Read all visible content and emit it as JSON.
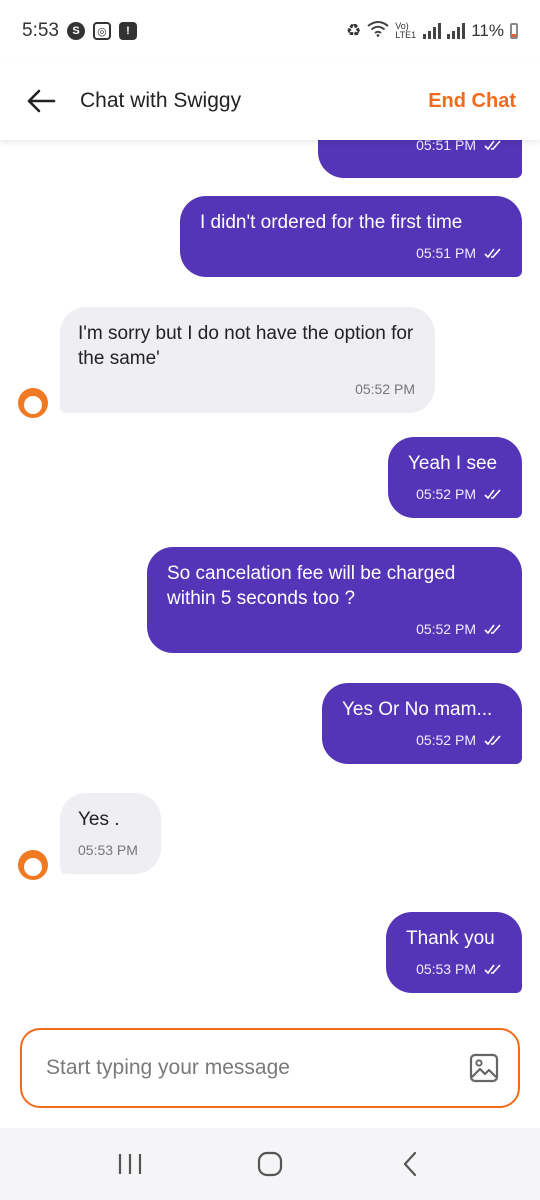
{
  "status_bar": {
    "time": "5:53",
    "battery_percent": "11%",
    "icons": [
      "skype-icon",
      "instagram-icon",
      "alert-icon",
      "battery-saver-icon",
      "wifi-icon",
      "signal-icon"
    ],
    "network_label": "Vo) LTE1"
  },
  "header": {
    "title": "Chat with Swiggy",
    "end_chat_label": "End Chat"
  },
  "messages": [
    {
      "from": "user",
      "text": "",
      "time": "05:51 PM"
    },
    {
      "from": "user",
      "text": "I didn't ordered for the first time",
      "time": "05:51 PM"
    },
    {
      "from": "agent",
      "text": "I'm sorry but I do not have the option for the same'",
      "time": "05:52 PM"
    },
    {
      "from": "user",
      "text": "Yeah I see",
      "time": "05:52 PM"
    },
    {
      "from": "user",
      "text": "So cancelation fee will be charged within 5 seconds too ?",
      "time": "05:52 PM"
    },
    {
      "from": "user",
      "text": "Yes Or No mam...",
      "time": "05:52 PM"
    },
    {
      "from": "agent",
      "text": "Yes .",
      "time": "05:53 PM"
    },
    {
      "from": "user",
      "text": "Thank you",
      "time": "05:53 PM"
    }
  ],
  "composer": {
    "placeholder": "Start typing your message",
    "value": ""
  },
  "colors": {
    "accent": "#f26b1d",
    "user_bubble": "#5535b7",
    "agent_bubble": "#efeff3"
  }
}
